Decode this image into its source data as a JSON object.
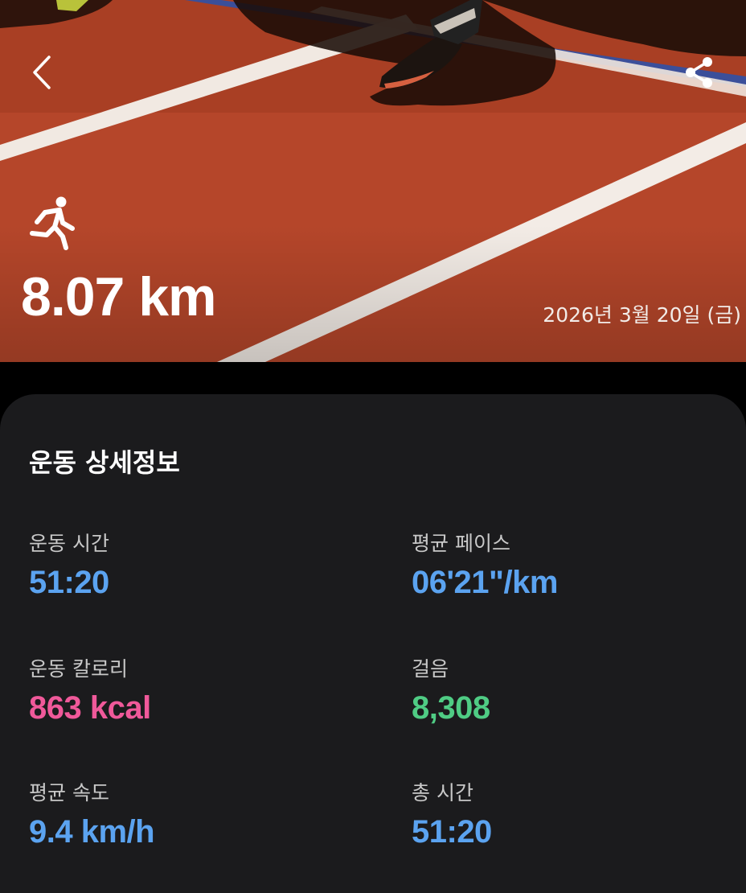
{
  "hero": {
    "distance": "8.07 km",
    "date": "2026년 3월 20일 (금)",
    "icons": {
      "back": "chevron-left-icon",
      "share": "share-icon",
      "activity": "running-icon"
    }
  },
  "details": {
    "title": "운동 상세정보",
    "stats": [
      {
        "label": "운동 시간",
        "value": "51:20",
        "color": "#5ba3f0"
      },
      {
        "label": "평균 페이스",
        "value": "06'21\"/km",
        "color": "#5ba3f0"
      },
      {
        "label": "운동 칼로리",
        "value": "863 kcal",
        "color": "#f0599a"
      },
      {
        "label": "걸음",
        "value": "8,308",
        "color": "#4fcc84"
      },
      {
        "label": "평균 속도",
        "value": "9.4 km/h",
        "color": "#5ba3f0"
      },
      {
        "label": "총 시간",
        "value": "51:20",
        "color": "#5ba3f0"
      }
    ]
  }
}
